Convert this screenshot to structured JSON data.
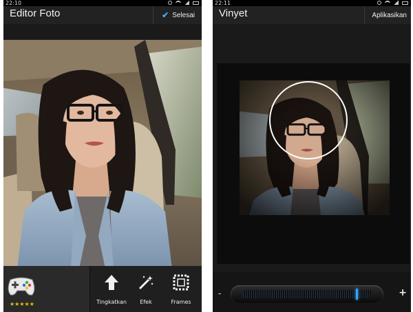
{
  "left_screen": {
    "status_time": "22:10",
    "title": "Editor Foto",
    "done_label": "Selesai",
    "rating": "★★★★★",
    "rating_value": 5,
    "tools": [
      {
        "label": "Tingkatkan",
        "icon": "arrow-up-icon"
      },
      {
        "label": "Efek",
        "icon": "magic-wand-icon"
      },
      {
        "label": "Frames",
        "icon": "frame-icon"
      }
    ]
  },
  "right_screen": {
    "status_time": "22:11",
    "title": "Vinyet",
    "apply_label": "Aplikasikan",
    "slider": {
      "minus": "-",
      "plus": "+",
      "value": 0.88
    }
  },
  "colors": {
    "accent": "#36a5ff",
    "check": "#4aa8f0",
    "stars": "#e8c200",
    "titlebar": "#222222"
  }
}
